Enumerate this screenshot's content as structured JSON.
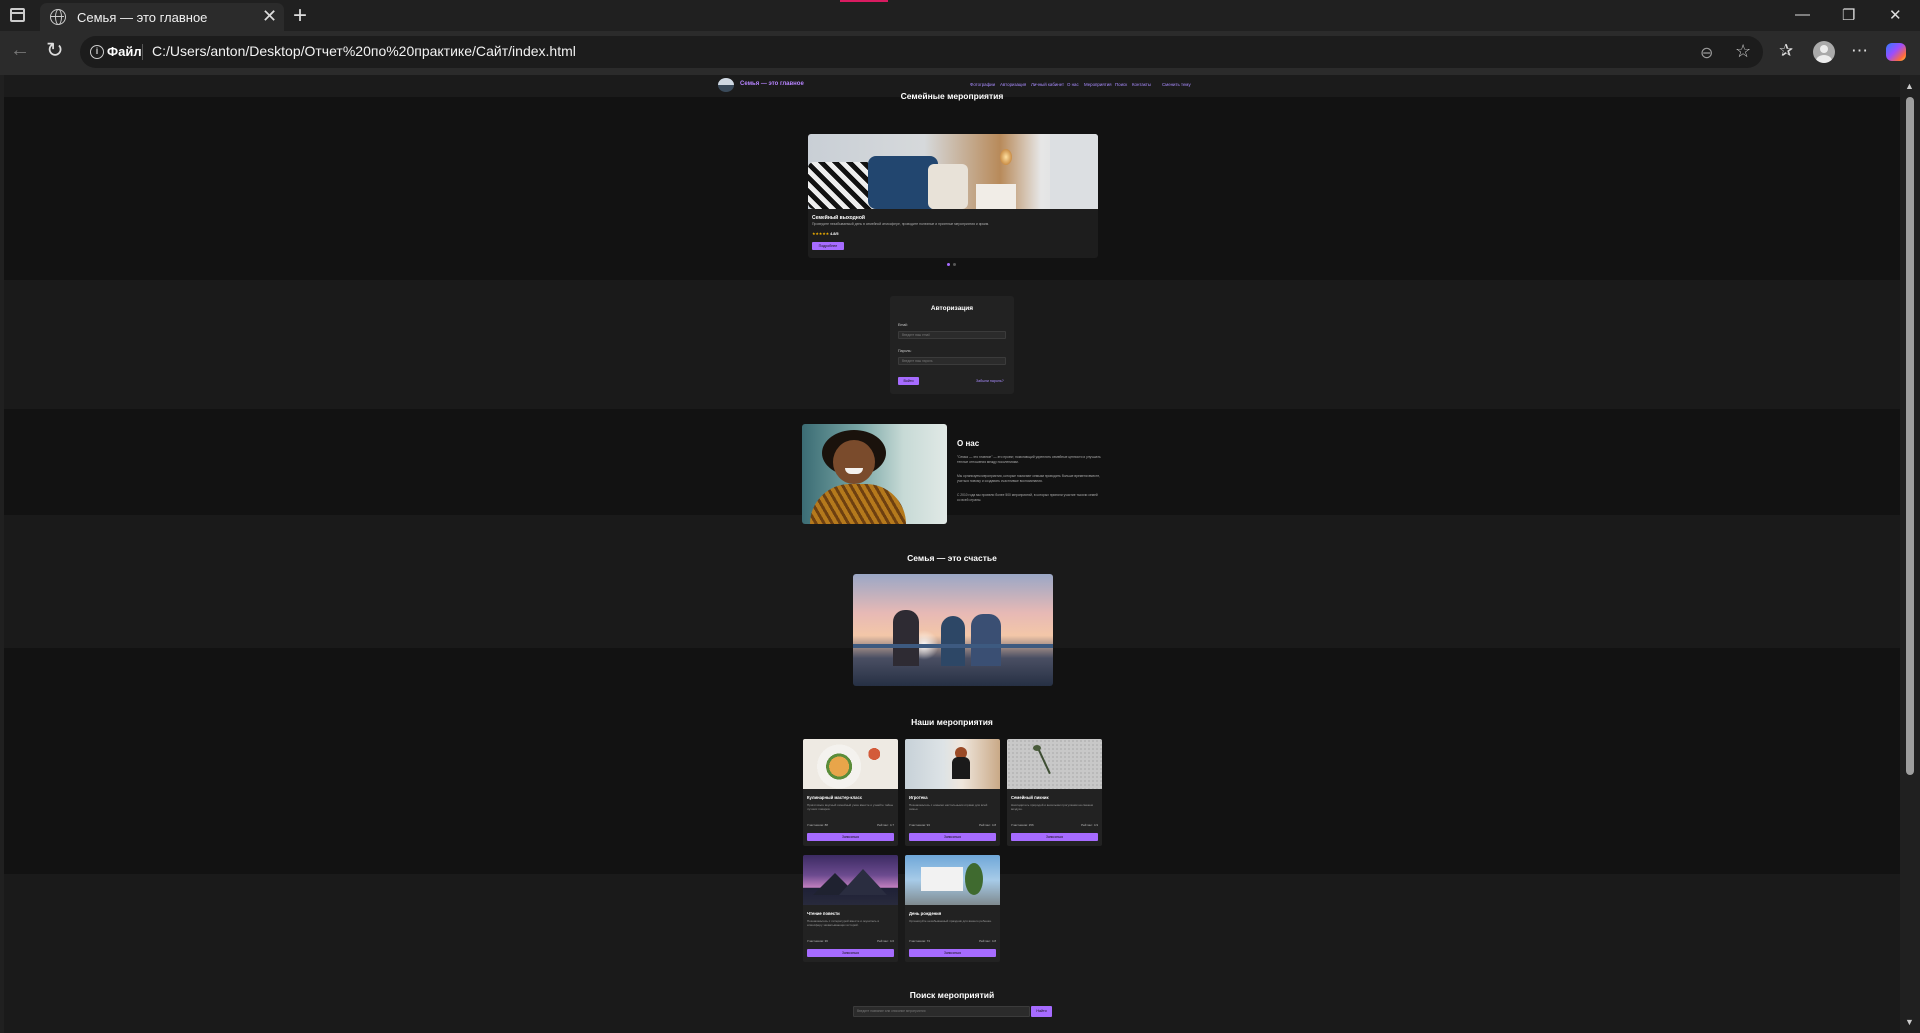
{
  "browser": {
    "tab_title": "Семья — это главное",
    "file_chip": "Файл",
    "url": "C:/Users/anton/Desktop/Отчет%20по%20практике/Сайт/index.html"
  },
  "site": {
    "brand": "Семья — это главное",
    "nav": [
      "Фотографии",
      "Авторизация",
      "Личный кабинет",
      "О нас",
      "Мероприятия",
      "Поиск",
      "Контакты",
      "Сменить тему"
    ]
  },
  "events_slider": {
    "title": "Семейные мероприятия",
    "card_title": "Семейный выходной",
    "card_desc": "Проведите незабываемый день в семейной атмосфере, проводите полезные и приятные мероприятия и ярким.",
    "rating_stars": "★★★★★",
    "rating_value": "4.8/5",
    "button": "Подробнее",
    "slides_count": 2,
    "active_slide": 1
  },
  "login": {
    "title": "Авторизация",
    "email_label": "Email:",
    "email_placeholder": "Введите ваш email",
    "password_label": "Пароль:",
    "password_placeholder": "Введите ваш пароль",
    "submit": "Войти",
    "forgot": "Забыли пароль?"
  },
  "about": {
    "title": "О нас",
    "paragraphs": [
      "\"Семья — это главное\" — это проект, помогающий укреплять семейные ценности и улучшать теплые отношения между поколениями.",
      "Мы организуем мероприятия, которые помогают семьям проводить больше времени вместе, учиться новому и создавать счастливые воспоминания.",
      "С 2010 года мы провели более 500 мероприятий, в которых приняли участие тысячи семей со всей страны."
    ]
  },
  "happiness": {
    "title": "Семья — это счастье"
  },
  "our_events": {
    "title": "Наши мероприятия",
    "cards": [
      {
        "title": "Кулинарный мастер-класс",
        "desc": "Приготовьте вкусный семейный ужин вместе и узнайте тайны лучших поваров.",
        "participants": "Участников: 88",
        "rating": "Рейтинг: 4.7",
        "button": "Записаться"
      },
      {
        "title": "Игротека",
        "desc": "Познакомьтесь с новыми настольными играми для всей семьи.",
        "participants": "Участников: 93",
        "rating": "Рейтинг: 4.8",
        "button": "Записаться"
      },
      {
        "title": "Семейный пикник",
        "desc": "Насладитесь природой и веселыми прогулками на свежем воздухе.",
        "participants": "Участников: 156",
        "rating": "Рейтинг: 4.9",
        "button": "Записаться"
      },
      {
        "title": "Чтение повести",
        "desc": "Познакомьтесь с литературой вместе и окунитесь в атмосферу захватывающих историй.",
        "participants": "Участников: 36",
        "rating": "Рейтинг: 4.6",
        "button": "Записаться"
      },
      {
        "title": "День рождения",
        "desc": "Организуйте незабываемый праздник для вашего ребенка.",
        "participants": "Участников: 73",
        "rating": "Рейтинг: 4.8",
        "button": "Записаться"
      }
    ]
  },
  "search": {
    "title": "Поиск мероприятий",
    "placeholder": "Введите название или описание мероприятия",
    "button": "Найти"
  },
  "colors": {
    "accent": "#a66bff",
    "page_bg": "#121212",
    "band_bg": "#1a1a1a",
    "card_bg": "#222222",
    "browser_tab_accent": "#d81b60"
  },
  "icons": [
    "sidebar-toggle-icon",
    "globe-icon",
    "close-icon",
    "plus-icon",
    "minimize-icon",
    "maximize-icon",
    "window-close-icon",
    "back-icon",
    "reload-icon",
    "info-icon",
    "zoom-icon",
    "favorite-star-icon",
    "favorites-icon",
    "avatar",
    "more-icon",
    "copilot-icon",
    "logo-icon"
  ]
}
